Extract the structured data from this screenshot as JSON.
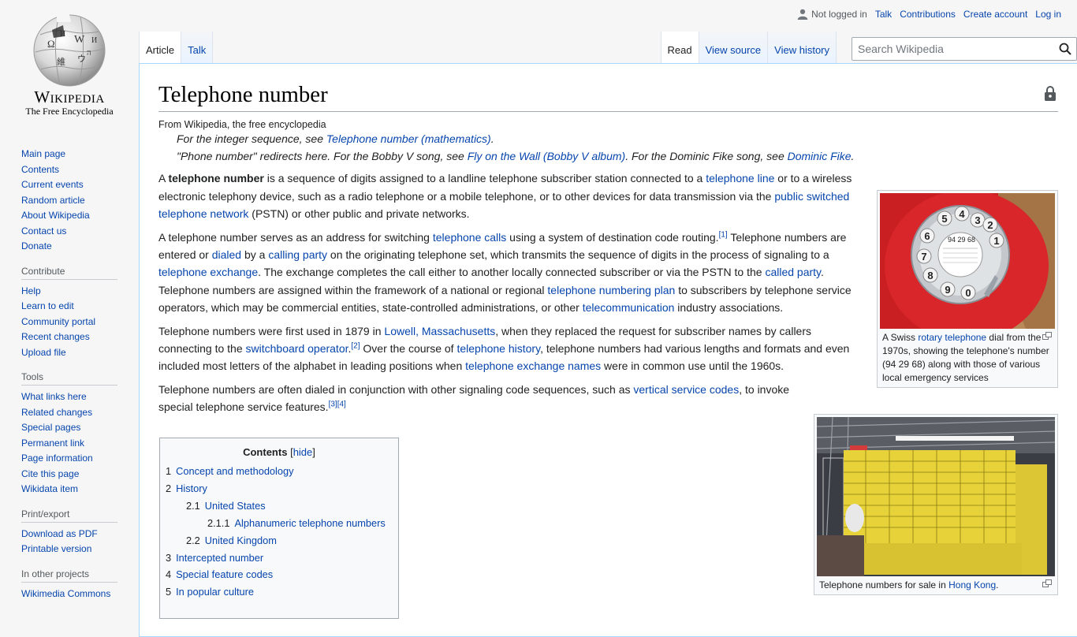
{
  "personal": {
    "not_logged_in": "Not logged in",
    "talk": "Talk",
    "contributions": "Contributions",
    "create_account": "Create account",
    "log_in": "Log in"
  },
  "logo": {
    "wordmark": "Wikipedia",
    "tagline": "The Free Encyclopedia"
  },
  "sidebar": {
    "navigation": [
      "Main page",
      "Contents",
      "Current events",
      "Random article",
      "About Wikipedia",
      "Contact us",
      "Donate"
    ],
    "contribute": {
      "heading": "Contribute",
      "items": [
        "Help",
        "Learn to edit",
        "Community portal",
        "Recent changes",
        "Upload file"
      ]
    },
    "tools": {
      "heading": "Tools",
      "items": [
        "What links here",
        "Related changes",
        "Special pages",
        "Permanent link",
        "Page information",
        "Cite this page",
        "Wikidata item"
      ]
    },
    "print": {
      "heading": "Print/export",
      "items": [
        "Download as PDF",
        "Printable version"
      ]
    },
    "other": {
      "heading": "In other projects",
      "items": [
        "Wikimedia Commons"
      ]
    }
  },
  "tabs": {
    "article": "Article",
    "talk": "Talk",
    "read": "Read",
    "view_source": "View source",
    "view_history": "View history"
  },
  "search": {
    "placeholder": "Search Wikipedia"
  },
  "article": {
    "title": "Telephone number",
    "site_sub": "From Wikipedia, the free encyclopedia",
    "hatnote1": {
      "pre": "For the integer sequence, see ",
      "link": "Telephone number (mathematics)",
      "post": "."
    },
    "hatnote2": {
      "pre": "\"Phone number\" redirects here. For the Bobby V song, see ",
      "link1": "Fly on the Wall (Bobby V album)",
      "mid": ". For the Dominic Fike song, see ",
      "link2": "Dominic Fike",
      "post": "."
    },
    "p1": {
      "a": "A ",
      "bold": "telephone number",
      "b": " is a sequence of digits assigned to a landline telephone subscriber station connected to a ",
      "l1": "telephone line",
      "c": " or to a wireless electronic telephony device, such as a radio telephone or a mobile telephone, or to other devices for data transmission via the ",
      "l2": "public switched telephone network",
      "d": " (PSTN) or other public and private networks."
    },
    "p2": {
      "a": "A telephone number serves as an address for switching ",
      "l1": "telephone calls",
      "b": " using a system of destination code routing.",
      "ref1": "[1]",
      "c": " Telephone numbers are entered or ",
      "l2": "dialed",
      "d": " by a ",
      "l3": "calling party",
      "e": " on the originating telephone set, which transmits the sequence of digits in the process of signaling to a ",
      "l4": "telephone exchange",
      "f": ". The exchange completes the call either to another locally connected subscriber or via the PSTN to the ",
      "l5": "called party",
      "g": ". Telephone numbers are assigned within the framework of a national or regional ",
      "l6": "telephone numbering plan",
      "h": " to subscribers by telephone service operators, which may be commercial entities, state-controlled administrations, or other ",
      "l7": "telecommunication",
      "i": " industry associations."
    },
    "p3": {
      "a": "Telephone numbers were first used in 1879 in ",
      "l1": "Lowell, Massachusetts",
      "b": ", when they replaced the request for subscriber names by callers connecting to the ",
      "l2": "switchboard operator",
      "c": ".",
      "ref2": "[2]",
      "d": " Over the course of ",
      "l3": "telephone history",
      "e": ", telephone numbers had various lengths and formats and even included most letters of the alphabet in leading positions when ",
      "l4": "telephone exchange names",
      "f": " were in common use until the 1960s."
    },
    "p4": {
      "a": "Telephone numbers are often dialed in conjunction with other signaling code sequences, such as ",
      "l1": "vertical service codes",
      "b": ", to invoke special telephone service features.",
      "ref3": "[3]",
      "ref4": "[4]"
    }
  },
  "thumb1": {
    "pre": "A Swiss ",
    "link": "rotary telephone",
    "post": " dial from the 1970s, showing the telephone's number (94 29 68) along with those of various local emergency services",
    "dial_number": "94 29 68"
  },
  "thumb2": {
    "pre": "Telephone numbers for sale in ",
    "link": "Hong Kong",
    "post": "."
  },
  "toc": {
    "title": "Contents",
    "toggle_open": "[",
    "toggle": "hide",
    "toggle_close": "]",
    "items": [
      {
        "num": "1",
        "label": "Concept and methodology",
        "level": 1
      },
      {
        "num": "2",
        "label": "History",
        "level": 1
      },
      {
        "num": "2.1",
        "label": "United States",
        "level": 2
      },
      {
        "num": "2.1.1",
        "label": "Alphanumeric telephone numbers",
        "level": 3
      },
      {
        "num": "2.2",
        "label": "United Kingdom",
        "level": 2
      },
      {
        "num": "3",
        "label": "Intercepted number",
        "level": 1
      },
      {
        "num": "4",
        "label": "Special feature codes",
        "level": 1
      },
      {
        "num": "5",
        "label": "In popular culture",
        "level": 1
      }
    ]
  },
  "colors": {
    "link": "#0645ad",
    "text": "#202122",
    "content_border": "#a7d7f9",
    "page_bg": "#f6f6f6",
    "phone_red": "#d42a2a",
    "sign_yellow": "#e8d23a"
  }
}
